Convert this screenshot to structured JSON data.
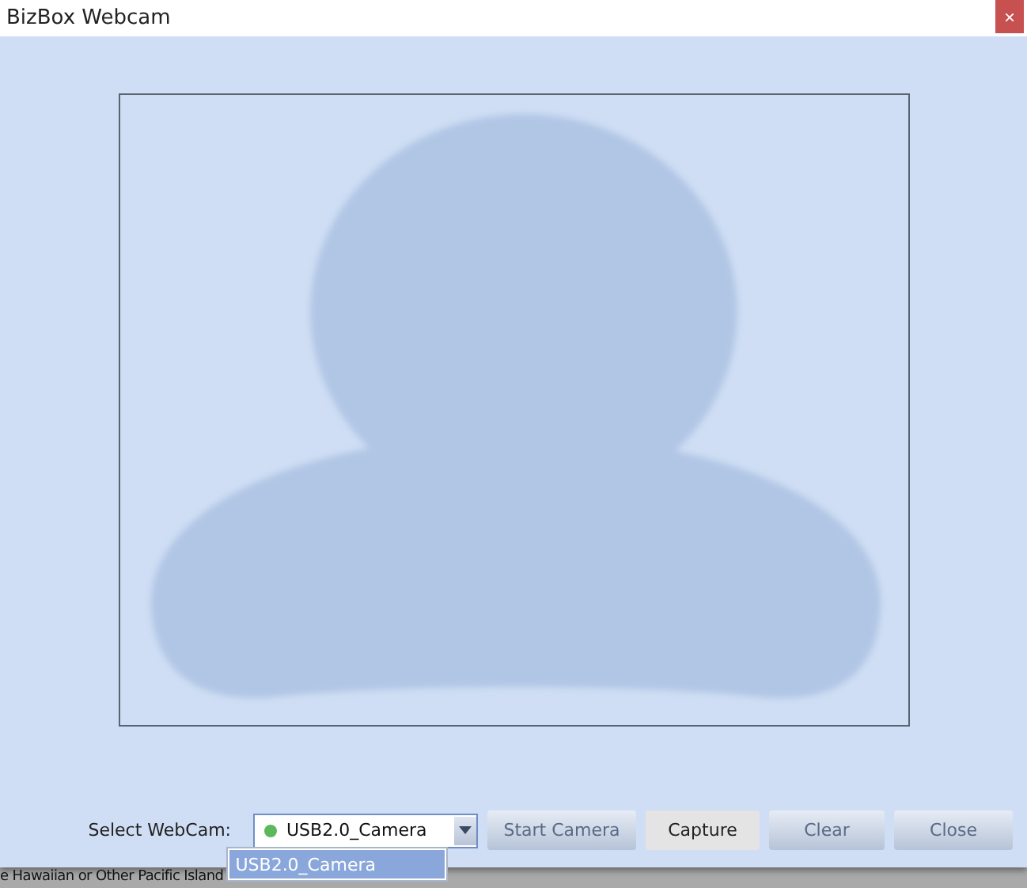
{
  "window": {
    "title": "BizBox Webcam",
    "close_icon": "×"
  },
  "webcam": {
    "label": "Select WebCam:",
    "value": "USB2.0_Camera",
    "connected": true,
    "expanded": true,
    "options": [
      {
        "label": "USB2.0_Camera",
        "selected": true
      }
    ]
  },
  "buttons": [
    {
      "label": "Start Camera",
      "highlighted": false
    },
    {
      "label": "Capture",
      "highlighted": true
    },
    {
      "label": "Clear",
      "highlighted": false
    },
    {
      "label": "Close",
      "highlighted": false
    }
  ],
  "background_text": "e Hawaiian or Other Pacific Island"
}
